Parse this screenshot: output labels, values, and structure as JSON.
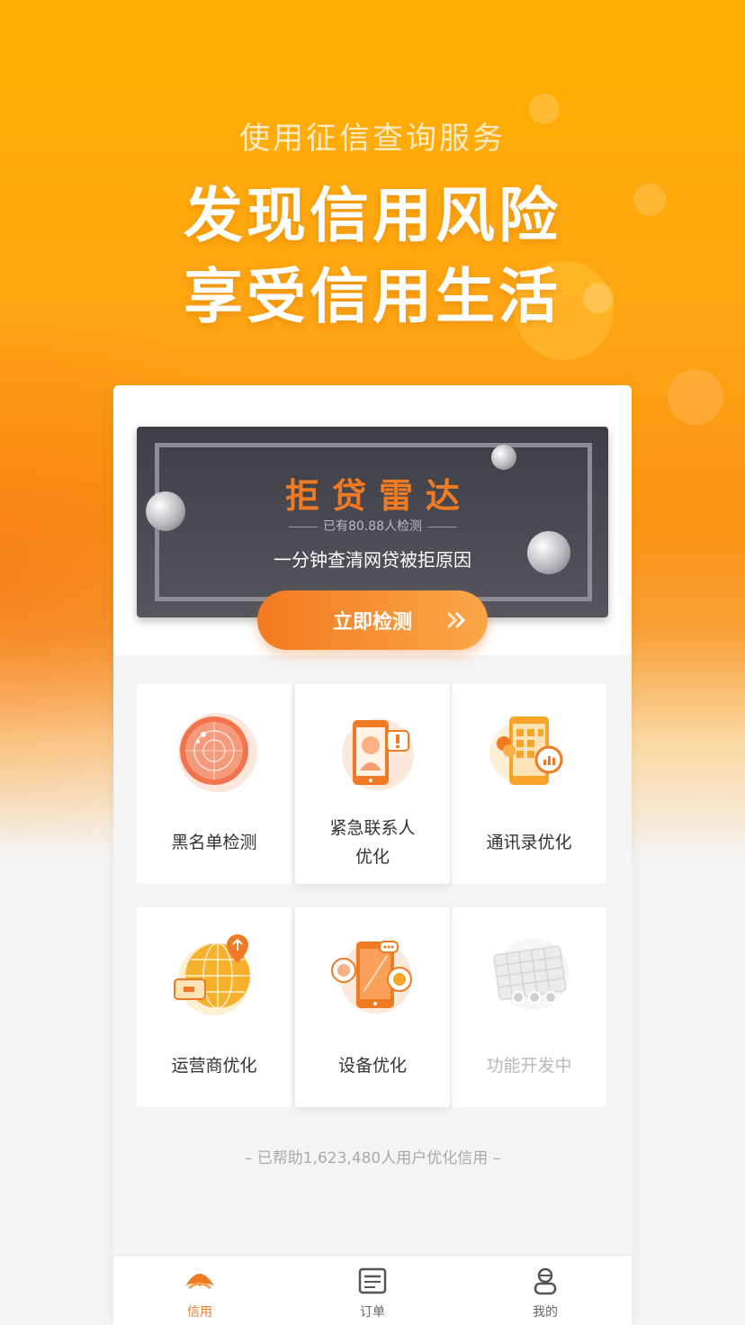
{
  "hero": {
    "subtitle": "使用征信查询服务",
    "title_line1": "发现信用风险",
    "title_line2": "享受信用生活"
  },
  "banner": {
    "title": "拒贷雷达",
    "count_text": "已有80.88人检测",
    "description": "一分钟查清网贷被拒原因",
    "cta_label": "立即检测"
  },
  "tiles": [
    {
      "label": "黑名单检测",
      "icon": "radar-icon"
    },
    {
      "label_line1": "紧急联系人",
      "label_line2": "优化",
      "icon": "phone-contact-icon"
    },
    {
      "label": "通讯录优化",
      "icon": "contacts-phone-icon"
    },
    {
      "label": "运营商优化",
      "icon": "globe-carrier-icon"
    },
    {
      "label": "设备优化",
      "icon": "device-chat-icon"
    },
    {
      "label": "功能开发中",
      "icon": "calendar-grid-icon",
      "disabled": true
    }
  ],
  "footer_note": "– 已帮助1,623,480人用户优化信用 –",
  "tabbar": {
    "items": [
      {
        "label": "信用",
        "icon": "umbrella-icon",
        "active": true
      },
      {
        "label": "订单",
        "icon": "order-list-icon",
        "active": false
      },
      {
        "label": "我的",
        "icon": "profile-icon",
        "active": false
      }
    ]
  },
  "colors": {
    "accent": "#f07a23",
    "hero_top": "#ffb000",
    "banner_bg": "#45454d"
  }
}
